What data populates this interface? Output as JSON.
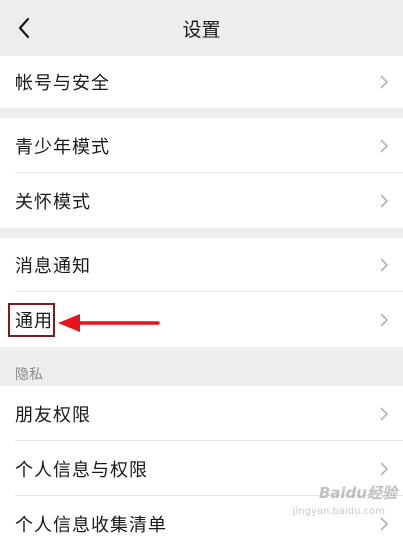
{
  "nav": {
    "title": "设置"
  },
  "groups": [
    {
      "items": [
        {
          "label": "帐号与安全"
        }
      ]
    },
    {
      "items": [
        {
          "label": "青少年模式"
        },
        {
          "label": "关怀模式"
        }
      ]
    },
    {
      "items": [
        {
          "label": "消息通知"
        },
        {
          "label": "通用"
        }
      ]
    },
    {
      "section_label": "隐私",
      "items": [
        {
          "label": "朋友权限"
        },
        {
          "label": "个人信息与权限"
        },
        {
          "label": "个人信息收集清单"
        }
      ]
    }
  ],
  "watermark": {
    "text": "Baidu经验",
    "sub": "jingyan.baidu.com"
  },
  "colors": {
    "background": "#ededed",
    "annotation_box": "#7a1c1c",
    "annotation_arrow": "#e8141a"
  }
}
